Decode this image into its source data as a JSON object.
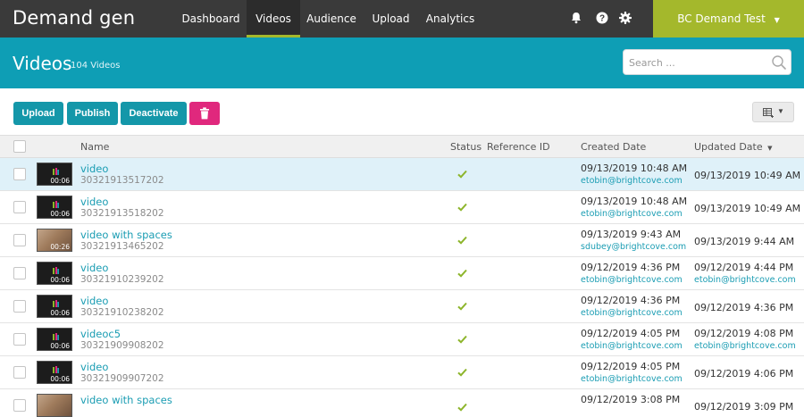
{
  "app": {
    "title": "Demand gen"
  },
  "nav": {
    "items": [
      {
        "label": "Dashboard",
        "active": false
      },
      {
        "label": "Videos",
        "active": true
      },
      {
        "label": "Audience",
        "active": false
      },
      {
        "label": "Upload",
        "active": false
      },
      {
        "label": "Analytics",
        "active": false
      }
    ],
    "icons": [
      "bell-icon",
      "help-icon",
      "gear-icon"
    ],
    "account_label": "BC Demand Test",
    "account_chevron": "▼"
  },
  "header": {
    "title": "Videos",
    "count": "104 Videos",
    "search_placeholder": "Search ..."
  },
  "toolbar": {
    "upload_label": "Upload",
    "publish_label": "Publish",
    "deactivate_label": "Deactivate",
    "view_chevron": "▼"
  },
  "table": {
    "columns": {
      "name": "Name",
      "status": "Status",
      "reference_id": "Reference ID",
      "created": "Created Date",
      "updated": "Updated Date",
      "sort_indicator": "▼"
    },
    "rows": [
      {
        "name": "video",
        "id": "30321913517202",
        "duration": "00:06",
        "thumb": "dark",
        "created": "09/13/2019 10:48 AM",
        "created_by": "etobin@brightcove.com",
        "updated": "09/13/2019 10:49 AM",
        "updated_by": "",
        "selected": true
      },
      {
        "name": "video",
        "id": "30321913518202",
        "duration": "00:06",
        "thumb": "dark",
        "created": "09/13/2019 10:48 AM",
        "created_by": "etobin@brightcove.com",
        "updated": "09/13/2019 10:49 AM",
        "updated_by": "",
        "selected": false
      },
      {
        "name": "video with spaces",
        "id": "30321913465202",
        "duration": "00:26",
        "thumb": "warm",
        "created": "09/13/2019 9:43 AM",
        "created_by": "sdubey@brightcove.com",
        "updated": "09/13/2019 9:44 AM",
        "updated_by": "",
        "selected": false
      },
      {
        "name": "video",
        "id": "30321910239202",
        "duration": "00:06",
        "thumb": "dark",
        "created": "09/12/2019 4:36 PM",
        "created_by": "etobin@brightcove.com",
        "updated": "09/12/2019 4:44 PM",
        "updated_by": "etobin@brightcove.com",
        "selected": false
      },
      {
        "name": "video",
        "id": "30321910238202",
        "duration": "00:06",
        "thumb": "dark",
        "created": "09/12/2019 4:36 PM",
        "created_by": "etobin@brightcove.com",
        "updated": "09/12/2019 4:36 PM",
        "updated_by": "",
        "selected": false
      },
      {
        "name": "videoc5",
        "id": "30321909908202",
        "duration": "00:06",
        "thumb": "dark",
        "created": "09/12/2019 4:05 PM",
        "created_by": "etobin@brightcove.com",
        "updated": "09/12/2019 4:08 PM",
        "updated_by": "etobin@brightcove.com",
        "selected": false
      },
      {
        "name": "video",
        "id": "30321909907202",
        "duration": "00:06",
        "thumb": "dark",
        "created": "09/12/2019 4:05 PM",
        "created_by": "etobin@brightcove.com",
        "updated": "09/12/2019 4:06 PM",
        "updated_by": "",
        "selected": false
      },
      {
        "name": "video with spaces",
        "id": "",
        "duration": "",
        "thumb": "warm",
        "created": "09/12/2019 3:08 PM",
        "created_by": "",
        "updated": "09/12/2019 3:09 PM",
        "updated_by": "",
        "selected": false
      }
    ]
  },
  "colors": {
    "topbar": "#3a3a3a",
    "accent_green": "#a4b82c",
    "header_teal": "#0e9eb5",
    "button_teal": "#1497a9",
    "delete_pink": "#e0287d",
    "link_teal": "#1b9db3",
    "status_check": "#8db52b"
  }
}
